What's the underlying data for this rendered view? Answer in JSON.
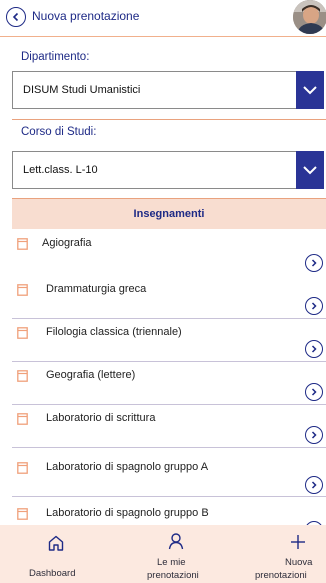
{
  "header": {
    "title": "Nuova prenotazione",
    "back_icon": "chevron-left-icon",
    "avatar": "user-avatar"
  },
  "department": {
    "label": "Dipartimento:",
    "value": "DISUM Studi Umanistici"
  },
  "course": {
    "label": "Corso di Studi:",
    "value": "Lett.class. L-10"
  },
  "list": {
    "header": "Insegnamenti",
    "items": [
      {
        "label": "Agiografia"
      },
      {
        "label": "Drammaturgia greca"
      },
      {
        "label": "Filologia classica (triennale)"
      },
      {
        "label": "Geografia (lettere)"
      },
      {
        "label": "Laboratorio di scrittura"
      },
      {
        "label": "Laboratorio di spagnolo gruppo A"
      },
      {
        "label": "Laboratorio di spagnolo gruppo B"
      }
    ]
  },
  "tabs": {
    "dashboard": "Dashboard",
    "mine_line1": "Le mie",
    "mine_line2": "prenotazioni",
    "new_line1": "Nuova",
    "new_line2": "prenotazioni"
  },
  "colors": {
    "accent": "#1e2a86",
    "dropdown": "#2a3496",
    "divider": "#e9a27e",
    "tabbar": "#fce9e0"
  }
}
